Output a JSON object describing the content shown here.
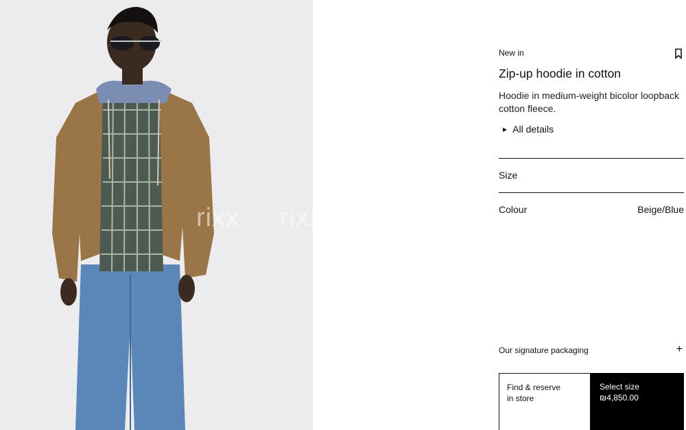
{
  "product": {
    "badge": "New in",
    "title": "Zip-up hoodie in cotton",
    "description": "Hoodie in medium-weight bicolor loopback cotton fleece.",
    "details_label": "All details"
  },
  "options": {
    "size_label": "Size",
    "colour_label": "Colour",
    "colour_value": "Beige/Blue"
  },
  "packaging": {
    "label": "Our signature packaging"
  },
  "actions": {
    "find_line1": "Find & reserve",
    "find_line2": "in store",
    "select_label": "Select size",
    "price": "₪4,850.00"
  },
  "watermark": [
    "rixx",
    "rixx"
  ],
  "colors": {
    "accent": "#000000",
    "photo_bg": "#ececee",
    "hoodie": "#9a7548",
    "jeans": "#5a87b8"
  },
  "icons": {
    "bookmark": "bookmark-icon",
    "plus": "plus-icon",
    "triangle": "triangle-right-icon"
  }
}
